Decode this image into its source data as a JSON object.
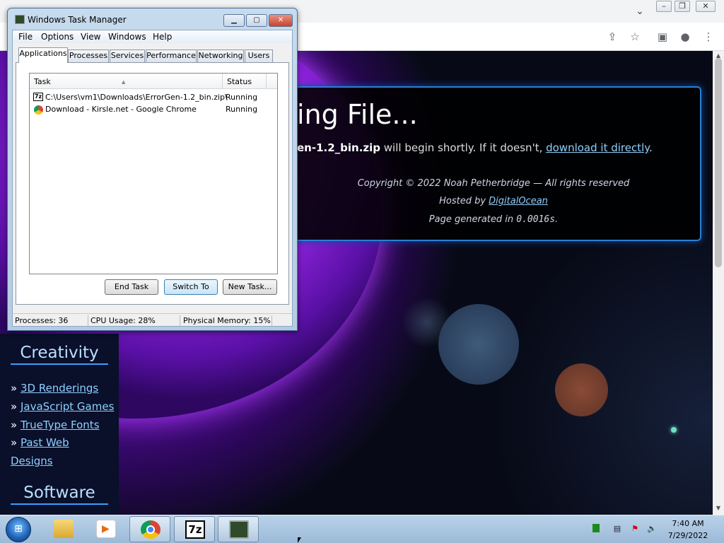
{
  "chrome": {
    "tab_dropdown_icon": "chevron-down-icon",
    "window_controls": {
      "minimize": "–",
      "maximize": "❐",
      "close": "✕"
    },
    "toolbar_icons": [
      "share-icon",
      "star-icon",
      "side-panel-icon",
      "profile-icon",
      "menu-icon"
    ]
  },
  "page": {
    "heading_partial": "ing File...",
    "message_prefix": "en-1.2_bin.zip",
    "message_middle": " will begin shortly. If it doesn't, ",
    "message_link": "download it directly",
    "message_suffix": ".",
    "copyright": "Copyright © 2022 Noah Petherbridge — All rights reserved",
    "hosted_prefix": "Hosted by ",
    "hosted_link": "DigitalOcean",
    "generated_prefix": "Page generated in ",
    "generated_value": "0.0016s",
    "generated_suffix": ".",
    "nav": {
      "creativity_heading": "Creativity",
      "links": [
        "3D Renderings",
        "JavaScript Games",
        "TrueType Fonts",
        "Past Web",
        "Designs"
      ],
      "software_heading": "Software"
    }
  },
  "taskmgr": {
    "title": "Windows Task Manager",
    "menu": [
      "File",
      "Options",
      "View",
      "Windows",
      "Help"
    ],
    "tabs": [
      "Applications",
      "Processes",
      "Services",
      "Performance",
      "Networking",
      "Users"
    ],
    "active_tab": "Applications",
    "columns": [
      "Task",
      "Status"
    ],
    "rows": [
      {
        "task": "C:\\Users\\vm1\\Downloads\\ErrorGen-1.2_bin.zip\\",
        "status": "Running",
        "icon": "7zip-icon"
      },
      {
        "task": "Download - Kirsle.net - Google Chrome",
        "status": "Running",
        "icon": "chrome-icon"
      }
    ],
    "buttons": {
      "end_task": "End Task",
      "switch_to": "Switch To",
      "new_task": "New Task..."
    },
    "status": {
      "processes": "Processes: 36",
      "cpu": "CPU Usage: 28%",
      "memory": "Physical Memory: 15%"
    }
  },
  "taskbar": {
    "apps": [
      "windows-explorer",
      "media-player",
      "google-chrome",
      "7-zip",
      "task-manager"
    ],
    "seven_zip_label": "7z",
    "time": "7:40 AM",
    "date": "7/29/2022"
  }
}
